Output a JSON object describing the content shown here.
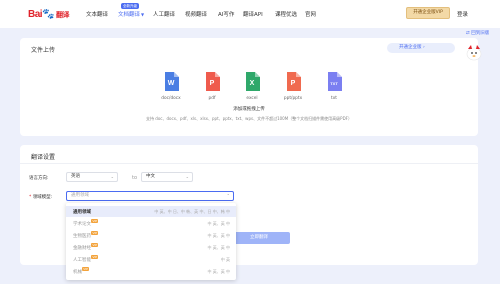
{
  "nav": {
    "logo": "Bai",
    "logo_paw": "🐾",
    "logo_suffix": "翻译",
    "items": [
      "文本翻译",
      "文档翻译",
      "人工翻译",
      "视频翻译",
      "AI写作",
      "翻译API",
      "课程优选",
      "官网"
    ],
    "new_badge": "全新升级",
    "vip": "开通企业版VIP",
    "login": "登录"
  },
  "old_version": "回到旧版",
  "upload": {
    "title": "文件上传",
    "enterprise": "开通企业版",
    "types": [
      {
        "label": "doc/docx",
        "color": "#4a7ee3",
        "glyph": "W"
      },
      {
        "label": "pdf",
        "color": "#ef5b4d",
        "glyph": "P"
      },
      {
        "label": "excel",
        "color": "#2fa86a",
        "glyph": "X"
      },
      {
        "label": "ppt/pptx",
        "color": "#f06a4f",
        "glyph": "P"
      },
      {
        "label": "txt",
        "color": "#7b7ff1",
        "glyph": "TXT"
      }
    ],
    "hint": "添加或拖拽上传",
    "hint2": "支持 doc、docx、pdf、xls、xlsx、ppt、pptx、txt、wps、文件不超过100M（整个文档扫描件需使用高级PDF）"
  },
  "settings": {
    "title": "翻译设置",
    "lang_label": "语言方向:",
    "source": "英语",
    "to": "to",
    "target": "中文",
    "domain_label": "领域模型:",
    "domain_placeholder": "通用领域",
    "translate": "立即翻译"
  },
  "dropdown": {
    "options": [
      {
        "name": "通用领域",
        "langs": "中 英、中 日、中 韩、英 中、日 中、韩 中",
        "vip": false,
        "selected": true
      },
      {
        "name": "学术论文",
        "langs": "中 英、英 中",
        "vip": true,
        "selected": false
      },
      {
        "name": "生物医药",
        "langs": "中 英、英 中",
        "vip": true,
        "selected": false
      },
      {
        "name": "金融财经",
        "langs": "中 英、英 中",
        "vip": true,
        "selected": false
      },
      {
        "name": "人工智能",
        "langs": "中 英",
        "vip": true,
        "selected": false
      },
      {
        "name": "机械",
        "langs": "中 英、英 中",
        "vip": true,
        "selected": false
      }
    ],
    "vip_badge": "VIP"
  }
}
